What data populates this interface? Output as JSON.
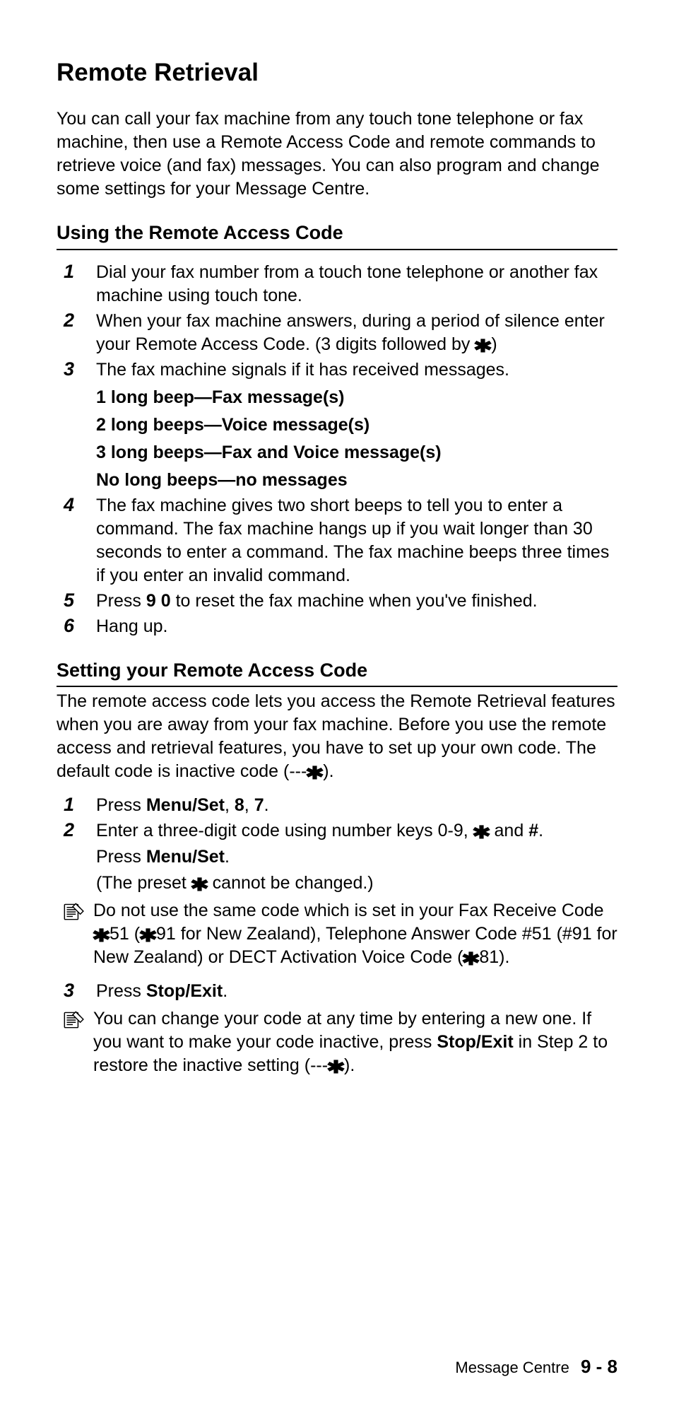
{
  "title": "Remote Retrieval",
  "intro": "You can call your fax machine from any touch tone telephone or fax machine, then use a Remote Access Code and remote commands to retrieve voice (and fax) messages. You can also program and change some settings for your Message Centre.",
  "sectionA": {
    "heading": "Using the Remote Access Code",
    "step1": "Dial your fax number from a touch tone telephone or another fax machine using touch tone.",
    "step2a": "When your fax machine answers, during a period of silence enter your Remote Access Code. (3 digits followed by ",
    "step2b": ")",
    "step3": "The fax machine signals if it has received messages.",
    "beep1": "1 long beep—Fax message(s)",
    "beep2": "2 long beeps—Voice message(s)",
    "beep3": "3 long beeps—Fax and Voice message(s)",
    "beep4": "No long beeps—no messages",
    "step4": "The fax machine gives two short beeps to tell you to enter a command. The fax machine hangs up if you wait longer than 30 seconds to enter a command. The fax machine beeps three times if you enter an invalid command.",
    "step5a": "Press ",
    "step5bold": "9 0",
    "step5b": " to reset the fax machine when you've finished.",
    "step6": "Hang up."
  },
  "sectionB": {
    "heading": "Setting your Remote Access Code",
    "intro_a": "The remote access code lets you access the Remote Retrieval features when you are away from your fax machine. Before you use the remote access and retrieval features, you have to set up your own code. The default code is inactive code (---",
    "intro_b": ").",
    "step1a": "Press ",
    "step1b": "Menu/Set",
    "step1c": ", ",
    "step1d": "8",
    "step1e": ", ",
    "step1f": "7",
    "step1g": ".",
    "step2a": "Enter a three-digit code using number keys 0-9, ",
    "step2b": " and ",
    "step2hash": "#",
    "step2c": ".",
    "step2d": "Press ",
    "step2e": "Menu/Set",
    "step2f": ".",
    "step2g": "(The preset ",
    "step2h": " cannot be changed.)",
    "note1a": "Do not use the same code which is set in your Fax Receive Code ",
    "note1b": "51 (",
    "note1c": "91 for New Zealand), Telephone Answer Code #51 (#91 for New Zealand) or DECT Activation Voice Code (",
    "note1d": "81).",
    "step3a": "Press ",
    "step3b": "Stop/Exit",
    "step3c": ".",
    "note2a": "You can change your code at any time by entering a new one. If you want to make your code inactive, press ",
    "note2b": "Stop/Exit",
    "note2c": " in Step 2 to restore the inactive setting (---",
    "note2d": ")."
  },
  "footer": {
    "label": "Message Centre",
    "page": "9 - 8"
  },
  "glyph": {
    "star": "✱"
  },
  "nums": {
    "n1": "1",
    "n2": "2",
    "n3": "3",
    "n4": "4",
    "n5": "5",
    "n6": "6"
  }
}
